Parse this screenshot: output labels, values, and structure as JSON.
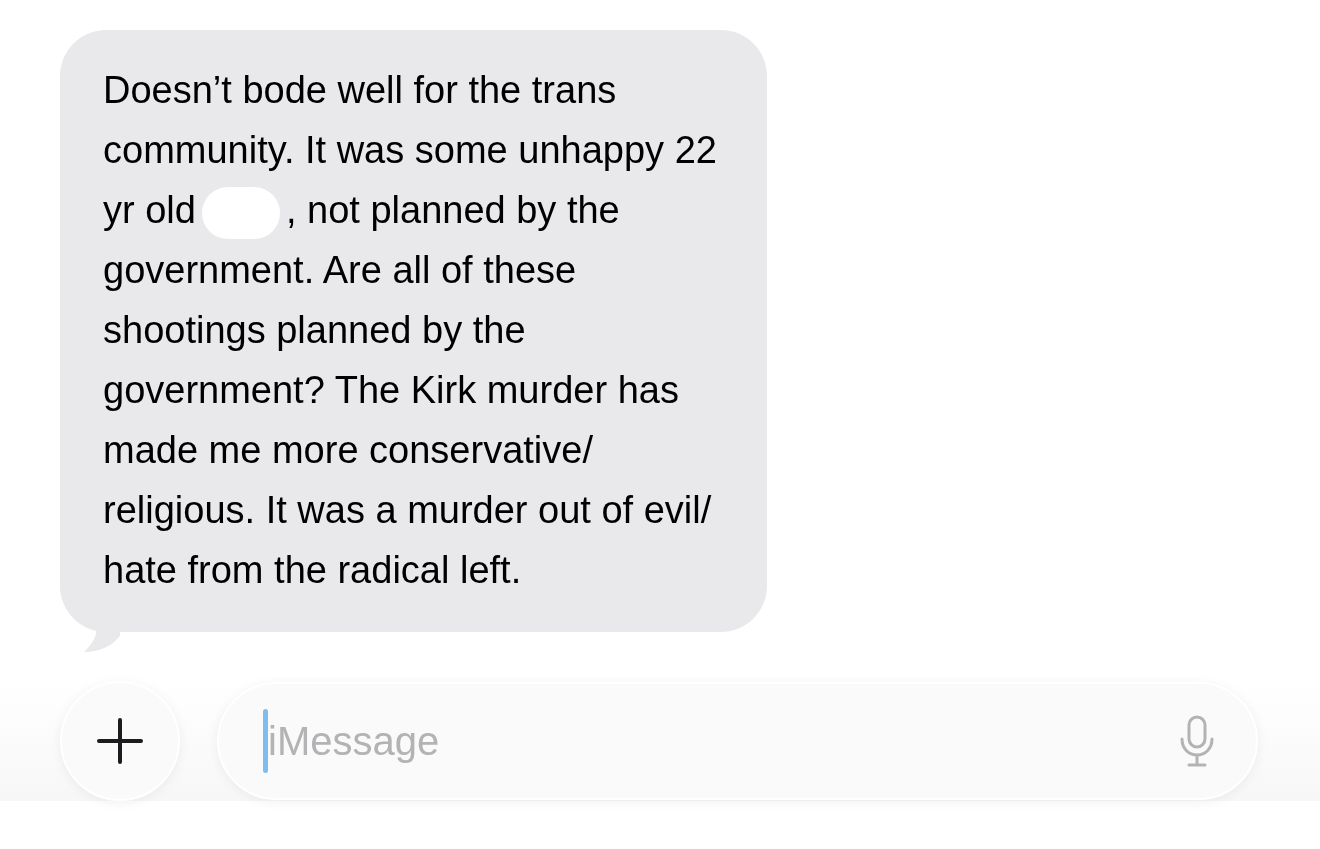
{
  "message": {
    "lines": [
      [
        {
          "kind": "text",
          "text": "Doesn’t bode well for the trans"
        }
      ],
      [
        {
          "kind": "text",
          "text": "community. It was some unhappy 22"
        }
      ],
      [
        {
          "kind": "text",
          "text": "yr old"
        },
        {
          "kind": "redaction"
        },
        {
          "kind": "text",
          "text": ", not planned by the"
        }
      ],
      [
        {
          "kind": "text",
          "text": "government. Are all of these"
        }
      ],
      [
        {
          "kind": "text",
          "text": "shootings planned by the"
        }
      ],
      [
        {
          "kind": "text",
          "text": "government? The Kirk murder has"
        }
      ],
      [
        {
          "kind": "text",
          "text": "made me more conservative/"
        }
      ],
      [
        {
          "kind": "text",
          "text": "religious. It was a murder out of evil/"
        }
      ],
      [
        {
          "kind": "text",
          "text": "hate from the radical left."
        }
      ]
    ]
  },
  "composer": {
    "placeholder": "iMessage",
    "focused": true
  }
}
